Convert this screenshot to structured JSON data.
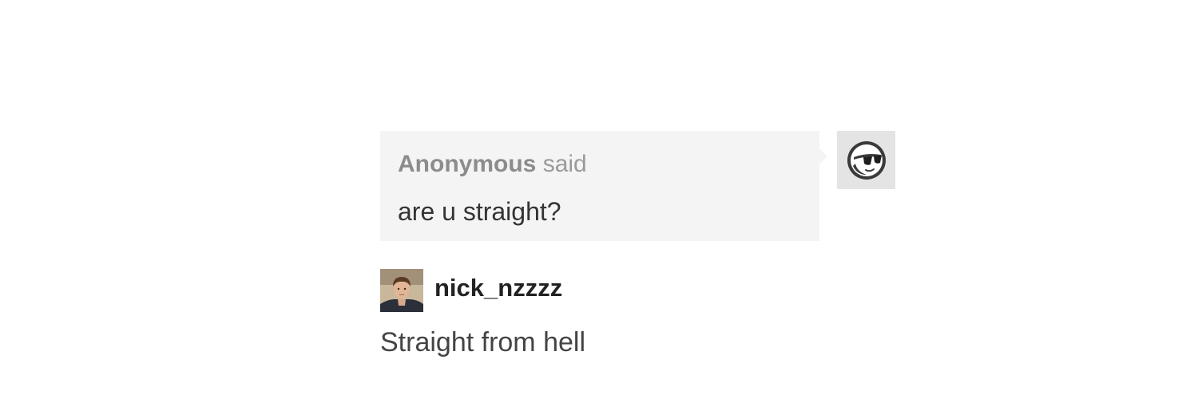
{
  "ask": {
    "asker_name": "Anonymous",
    "said_label": "said",
    "question": "are u straight?",
    "asker_avatar_icon": "sunglasses-face-icon"
  },
  "answer": {
    "username": "nick_nzzzz",
    "text": "Straight from hell",
    "avatar_icon": "user-photo-avatar"
  },
  "colors": {
    "bubble_bg": "#f4f4f4",
    "asker_text": "#8c8c8c",
    "body_text": "#333333"
  }
}
